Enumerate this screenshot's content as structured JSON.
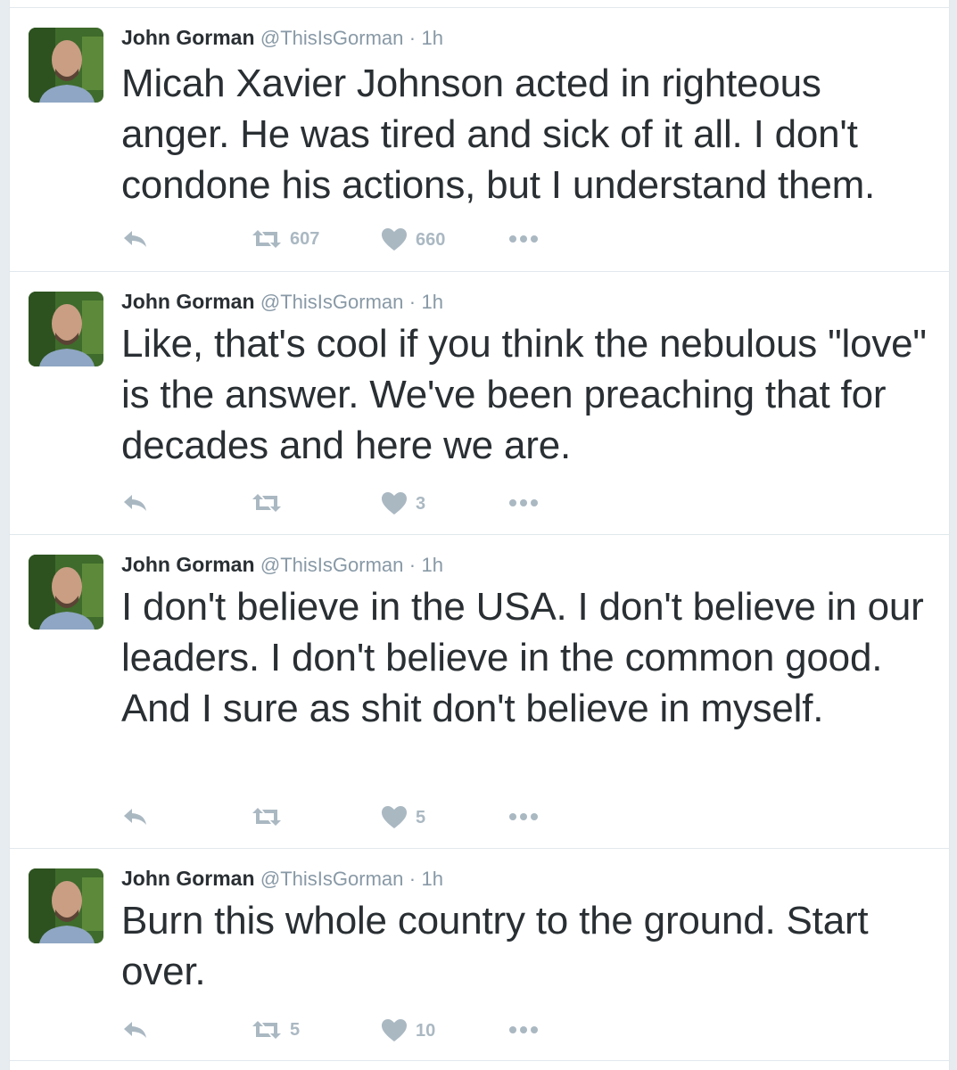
{
  "tweets": [
    {
      "name": "John Gorman",
      "handle": "@ThisIsGorman",
      "separator": "·",
      "time": "1h",
      "text": "Micah Xavier Johnson acted in righteous anger. He was tired and sick of it all. I don't condone his actions, but I understand them.",
      "retweets": "607",
      "likes": "660"
    },
    {
      "name": "John Gorman",
      "handle": "@ThisIsGorman",
      "separator": "·",
      "time": "1h",
      "text": "Like, that's cool if you think the nebulous \"love\" is the answer. We've been preaching that for decades and here we are.",
      "retweets": "",
      "likes": "3"
    },
    {
      "name": "John Gorman",
      "handle": "@ThisIsGorman",
      "separator": "·",
      "time": "1h",
      "text": "I don't believe in the USA. I don't believe in our leaders. I don't believe in the common good. And I sure as shit don't believe in myself.",
      "retweets": "",
      "likes": "5"
    },
    {
      "name": "John Gorman",
      "handle": "@ThisIsGorman",
      "separator": "·",
      "time": "1h",
      "text": "Burn this whole country to the ground. Start over.",
      "retweets": "5",
      "likes": "10"
    }
  ],
  "icons": {
    "reply": "reply-icon",
    "retweet": "retweet-icon",
    "like": "heart-icon",
    "more": "more-options-icon"
  },
  "colors": {
    "text": "#292f33",
    "muted": "#8899a6",
    "action": "#aab8c2",
    "border": "#e1e8ed"
  }
}
